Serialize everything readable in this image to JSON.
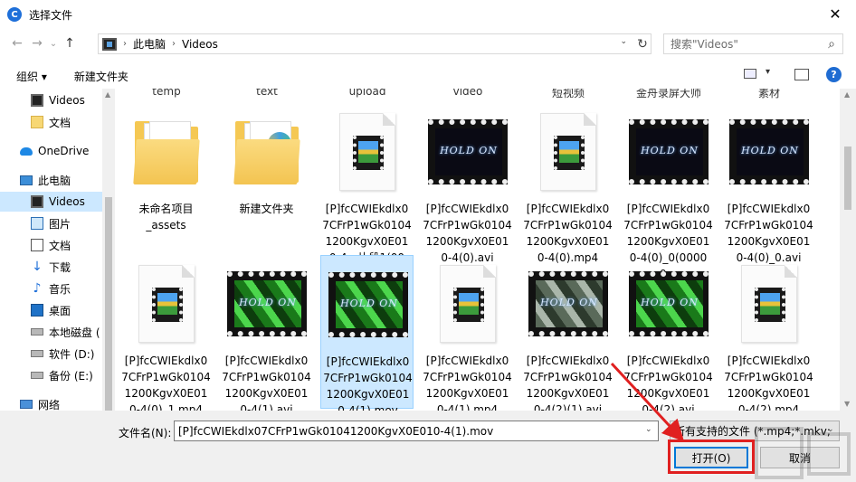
{
  "window": {
    "title": "选择文件",
    "close": "✕"
  },
  "nav": {
    "back": "←",
    "forward": "→",
    "recent": "⌄",
    "up": "↑",
    "breadcrumb": [
      "此电脑",
      "Videos"
    ],
    "refresh": "↻",
    "search_placeholder": "搜索\"Videos\"",
    "search_icon": "⌕"
  },
  "toolbar": {
    "organize": "组织 ▾",
    "new_folder": "新建文件夹",
    "help": "?"
  },
  "sidebar": {
    "items": [
      {
        "label": "Videos",
        "icon": "film-icon"
      },
      {
        "label": "文档",
        "icon": "folder-icon"
      },
      {
        "label": "OneDrive",
        "icon": "cloud-icon"
      },
      {
        "label": "此电脑",
        "icon": "computer-icon"
      },
      {
        "label": "Videos",
        "icon": "film-icon",
        "selected": true
      },
      {
        "label": "图片",
        "icon": "pictures-icon"
      },
      {
        "label": "文档",
        "icon": "document-icon"
      },
      {
        "label": "下载",
        "icon": "download-icon"
      },
      {
        "label": "音乐",
        "icon": "music-icon"
      },
      {
        "label": "桌面",
        "icon": "desktop-icon"
      },
      {
        "label": "本地磁盘 (",
        "icon": "disk-icon"
      },
      {
        "label": "软件 (D:)",
        "icon": "disk-icon"
      },
      {
        "label": "备份 (E:)",
        "icon": "disk-icon"
      },
      {
        "label": "网络",
        "icon": "network-icon"
      }
    ]
  },
  "cut_row": [
    "temp",
    "text",
    "upload",
    "video",
    "短视频",
    "金舟录屏大师",
    "素材"
  ],
  "files": [
    {
      "label": "未命名项目\n_assets",
      "kind": "folder"
    },
    {
      "label": "新建文件夹",
      "kind": "folder-media"
    },
    {
      "label": "[P]fcCWIEkdlx07CFrP1wGk01041200KgvX0E010-4 - 片段1(00_...",
      "kind": "doc"
    },
    {
      "label": "[P]fcCWIEkdlx07CFrP1wGk01041200KgvX0E010-4(0).avi",
      "kind": "film-dark",
      "caption": "HOLD ON"
    },
    {
      "label": "[P]fcCWIEkdlx07CFrP1wGk01041200KgvX0E010-4(0).mp4",
      "kind": "doc"
    },
    {
      "label": "[P]fcCWIEkdlx07CFrP1wGk01041200KgvX0E010-4(0)_0(00000...",
      "kind": "film-dark",
      "caption": "HOLD ON"
    },
    {
      "label": "[P]fcCWIEkdlx07CFrP1wGk01041200KgvX0E010-4(0)_0.avi",
      "kind": "film-dark",
      "caption": "HOLD ON"
    },
    {
      "label": "[P]fcCWIEkdlx07CFrP1wGk01041200KgvX0E010-4(0)_1.mp4",
      "kind": "doc"
    },
    {
      "label": "[P]fcCWIEkdlx07CFrP1wGk01041200KgvX0E010-4(1).avi",
      "kind": "film-green",
      "caption": "HOLD ON"
    },
    {
      "label": "[P]fcCWIEkdlx07CFrP1wGk01041200KgvX0E010-4(1).mov",
      "kind": "film-green",
      "caption": "HOLD ON",
      "selected": true
    },
    {
      "label": "[P]fcCWIEkdlx07CFrP1wGk01041200KgvX0E010-4(1).mp4",
      "kind": "doc"
    },
    {
      "label": "[P]fcCWIEkdlx07CFrP1wGk01041200KgvX0E010-4(2)(1).avi",
      "kind": "film-gray",
      "caption": "HOLD ON"
    },
    {
      "label": "[P]fcCWIEkdlx07CFrP1wGk01041200KgvX0E010-4(2).avi",
      "kind": "film-green",
      "caption": "HOLD ON"
    },
    {
      "label": "[P]fcCWIEkdlx07CFrP1wGk01041200KgvX0E010-4(2).mp4",
      "kind": "doc"
    }
  ],
  "footer": {
    "filename_label": "文件名(N):",
    "filename_value": "[P]fcCWIEkdlx07CFrP1wGk01041200KgvX0E010-4(1).mov",
    "filetype_value": "所有支持的文件 (*.mp4;*.mkv;",
    "open_label": "打开(O)",
    "cancel_label": "取消"
  },
  "colors": {
    "accent": "#0078d7",
    "selection": "#cce8ff",
    "annotation": "#e02020"
  }
}
